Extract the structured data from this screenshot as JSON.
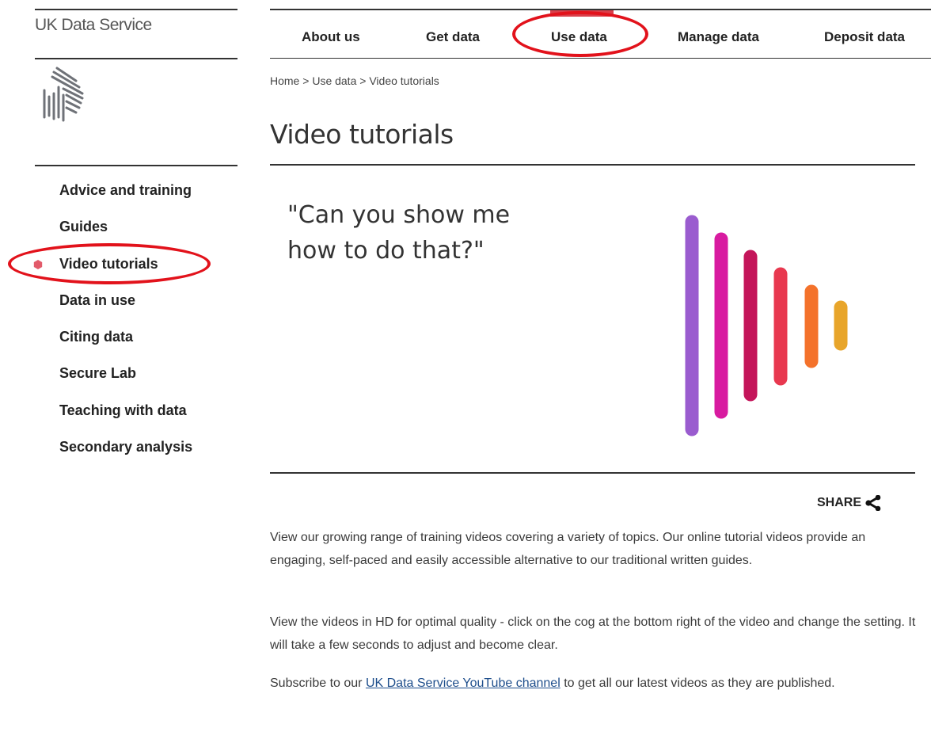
{
  "brand": {
    "name": "UK Data Service"
  },
  "topnav": {
    "items": [
      {
        "label": "About us"
      },
      {
        "label": "Get data"
      },
      {
        "label": "Use data"
      },
      {
        "label": "Manage data"
      },
      {
        "label": "Deposit data"
      }
    ],
    "active_label": "Use data"
  },
  "breadcrumb": {
    "home": "Home",
    "section": "Use data",
    "current": "Video tutorials",
    "separator": ">"
  },
  "page": {
    "title": "Video tutorials"
  },
  "banner": {
    "quote_line1": "\"Can you show me",
    "quote_line2": "how to do that?\"",
    "bar_colors": [
      "#9a5ccf",
      "#d81ba0",
      "#c4155a",
      "#e8384f",
      "#f4722b",
      "#e8a52a"
    ]
  },
  "sidebar": {
    "items": [
      {
        "label": "Advice and training"
      },
      {
        "label": "Guides"
      },
      {
        "label": "Video tutorials"
      },
      {
        "label": "Data in use"
      },
      {
        "label": "Citing data"
      },
      {
        "label": "Secure Lab"
      },
      {
        "label": "Teaching with data"
      },
      {
        "label": "Secondary analysis"
      }
    ],
    "active_label": "Video tutorials",
    "bullet_color": "#e25a6a"
  },
  "share": {
    "label": "SHARE"
  },
  "body": {
    "p1": "View our growing range of training videos covering a variety of topics. Our online tutorial videos provide an engaging, self-paced and easily accessible alternative to our traditional written guides.",
    "p2": "View the videos in HD for optimal quality - click on the cog at the bottom right of the video and change the setting. It will take a few seconds to adjust and become clear.",
    "p3_before": "Subscribe to our ",
    "p3_link": "UK Data Service YouTube channel",
    "p3_after": " to get all our latest videos as they are published."
  },
  "colors": {
    "annotation": "#e2121b",
    "active_tab_bar": "#d9404b",
    "link": "#1e4e8c"
  }
}
